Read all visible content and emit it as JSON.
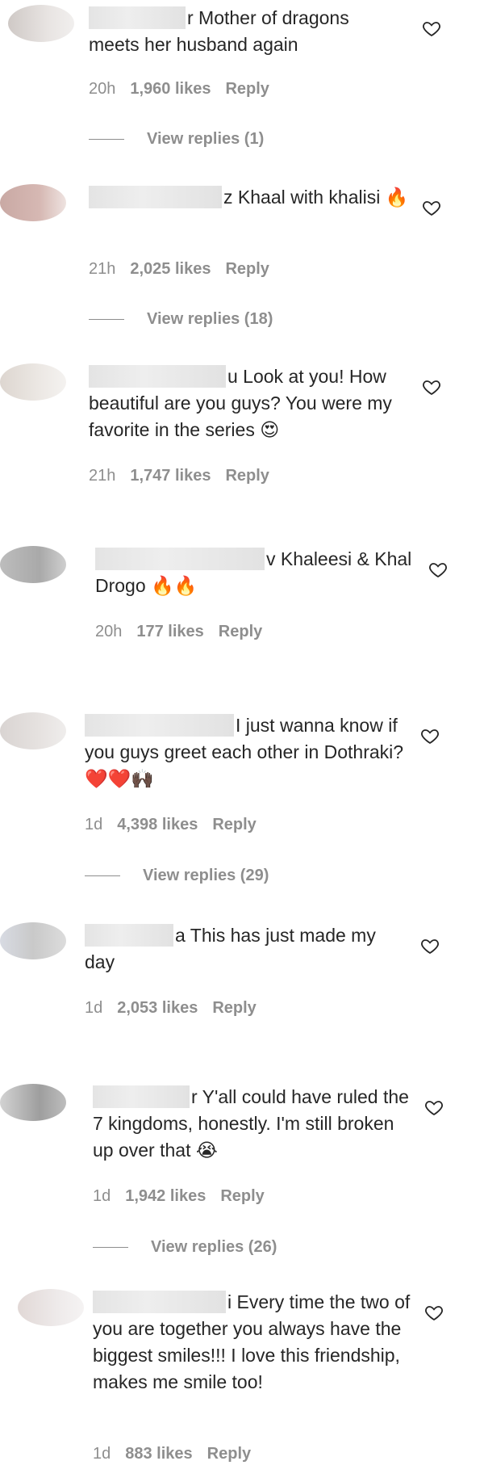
{
  "comments": [
    {
      "text": "r Mother of dragons meets her husband again",
      "time": "20h",
      "likes": "1,960 likes",
      "reply": "Reply",
      "view_replies": "View replies (1)"
    },
    {
      "text": "z Khaal with khalisi 🔥",
      "time": "21h",
      "likes": "2,025 likes",
      "reply": "Reply",
      "view_replies": "View replies (18)"
    },
    {
      "text": "u Look at you! How beautiful are you guys? You were my favorite in the series 😍",
      "time": "21h",
      "likes": "1,747 likes",
      "reply": "Reply",
      "view_replies": ""
    },
    {
      "text": "v Khaleesi & Khal Drogo 🔥🔥",
      "time": "20h",
      "likes": "177 likes",
      "reply": "Reply",
      "view_replies": ""
    },
    {
      "text": "I just wanna know if you guys greet each other in Dothraki? ❤️❤️🙌🏿",
      "time": "1d",
      "likes": "4,398 likes",
      "reply": "Reply",
      "view_replies": "View replies (29)"
    },
    {
      "text": "a This has just made my day",
      "time": "1d",
      "likes": "2,053 likes",
      "reply": "Reply",
      "view_replies": ""
    },
    {
      "text": "r Y'all could have ruled the 7 kingdoms, honestly. I'm still broken up over that 😭",
      "time": "1d",
      "likes": "1,942 likes",
      "reply": "Reply",
      "view_replies": "View replies (26)"
    },
    {
      "text": "i Every time the two of you are together you always have the biggest smiles!!! I love this friendship, makes me smile too!",
      "time": "1d",
      "likes": "883 likes",
      "reply": "Reply",
      "view_replies": ""
    }
  ]
}
